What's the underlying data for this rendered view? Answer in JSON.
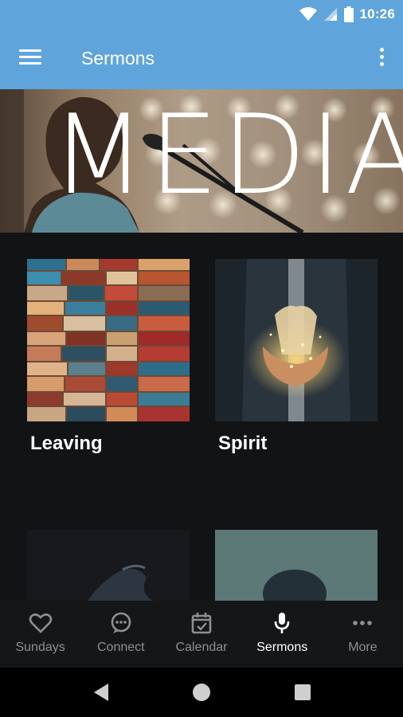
{
  "status_bar": {
    "time": "10:26",
    "icons": [
      "wifi-icon",
      "signal-icon",
      "battery-icon"
    ]
  },
  "app_bar": {
    "title": "Sermons",
    "menu_icon": "menu-icon",
    "overflow_icon": "more-vert-icon"
  },
  "hero": {
    "word": "MEDIA"
  },
  "series": [
    {
      "title": "Leaving",
      "image": "stacked-suitcases"
    },
    {
      "title": "Spirit",
      "image": "hands-holding-lights"
    },
    {
      "title": "",
      "image": "raised-hand-dark"
    },
    {
      "title": "",
      "image": "person-teal-background"
    }
  ],
  "bottom_nav": {
    "items": [
      {
        "label": "Sundays",
        "icon": "heart-icon",
        "active": false
      },
      {
        "label": "Connect",
        "icon": "chat-bubble-icon",
        "active": false
      },
      {
        "label": "Calendar",
        "icon": "calendar-icon",
        "active": false
      },
      {
        "label": "Sermons",
        "icon": "microphone-icon",
        "active": true
      },
      {
        "label": "More",
        "icon": "more-horiz-icon",
        "active": false
      }
    ]
  },
  "system_nav": {
    "icons": [
      "back-icon",
      "home-icon",
      "recents-icon"
    ]
  },
  "colors": {
    "app_bar": "#5fa5dc",
    "background": "#121315",
    "nav_inactive": "#8d8f92",
    "nav_active": "#ffffff"
  }
}
